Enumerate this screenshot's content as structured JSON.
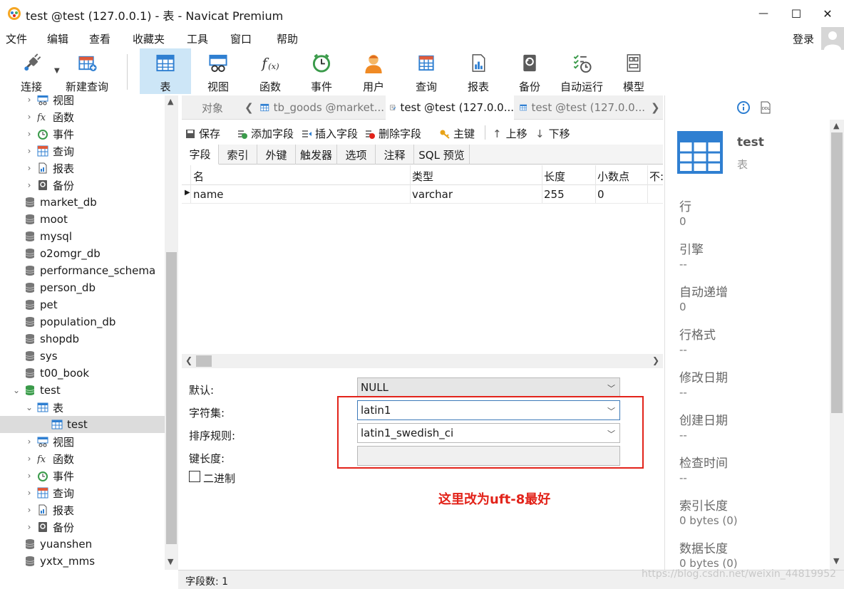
{
  "window": {
    "title": "test @test (127.0.0.1) - 表 - Navicat Premium",
    "minimize": "—",
    "maximize": "☐",
    "close": "✕"
  },
  "menu": [
    "文件",
    "编辑",
    "查看",
    "收藏夹",
    "工具",
    "窗口",
    "帮助"
  ],
  "login_label": "登录",
  "toolbar": [
    {
      "label": "连接",
      "icon": "plug-icon"
    },
    {
      "label": "新建查询",
      "icon": "new-query-icon"
    },
    {
      "label": "表",
      "icon": "table-icon"
    },
    {
      "label": "视图",
      "icon": "view-icon"
    },
    {
      "label": "函数",
      "icon": "function-icon"
    },
    {
      "label": "事件",
      "icon": "clock-icon"
    },
    {
      "label": "用户",
      "icon": "user-icon"
    },
    {
      "label": "查询",
      "icon": "query-icon"
    },
    {
      "label": "报表",
      "icon": "report-icon"
    },
    {
      "label": "备份",
      "icon": "backup-icon"
    },
    {
      "label": "自动运行",
      "icon": "schedule-icon"
    },
    {
      "label": "模型",
      "icon": "model-icon"
    }
  ],
  "tree": [
    {
      "label": "视图",
      "type": "view"
    },
    {
      "label": "函数",
      "type": "function"
    },
    {
      "label": "事件",
      "type": "event"
    },
    {
      "label": "查询",
      "type": "query"
    },
    {
      "label": "报表",
      "type": "report"
    },
    {
      "label": "备份",
      "type": "backup"
    },
    {
      "label": "market_db",
      "type": "db"
    },
    {
      "label": "moot",
      "type": "db"
    },
    {
      "label": "mysql",
      "type": "db"
    },
    {
      "label": "o2omgr_db",
      "type": "db"
    },
    {
      "label": "performance_schema",
      "type": "db"
    },
    {
      "label": "person_db",
      "type": "db"
    },
    {
      "label": "pet",
      "type": "db"
    },
    {
      "label": "population_db",
      "type": "db"
    },
    {
      "label": "shopdb",
      "type": "db"
    },
    {
      "label": "sys",
      "type": "db"
    },
    {
      "label": "t00_book",
      "type": "db"
    },
    {
      "label": "test",
      "type": "db-open"
    },
    {
      "label": "表",
      "type": "tables"
    },
    {
      "label": "test",
      "type": "table"
    },
    {
      "label": "视图",
      "type": "view"
    },
    {
      "label": "函数",
      "type": "function"
    },
    {
      "label": "事件",
      "type": "event"
    },
    {
      "label": "查询",
      "type": "query"
    },
    {
      "label": "报表",
      "type": "report"
    },
    {
      "label": "备份",
      "type": "backup"
    },
    {
      "label": "yuanshen",
      "type": "db"
    },
    {
      "label": "yxtx_mms",
      "type": "db"
    }
  ],
  "tabs": {
    "objects": "对象",
    "items": [
      "tb_goods @market...",
      "test @test (127.0.0...",
      "test @test (127.0.0..."
    ]
  },
  "editor_toolbar": [
    "保存",
    "添加字段",
    "插入字段",
    "删除字段",
    "主键",
    "上移",
    "下移"
  ],
  "subtabs": [
    "字段",
    "索引",
    "外键",
    "触发器",
    "选项",
    "注释",
    "SQL 预览"
  ],
  "grid": {
    "columns": [
      "名",
      "类型",
      "长度",
      "小数点",
      "不:"
    ],
    "rows": [
      {
        "name": "name",
        "type": "varchar",
        "length": "255",
        "decimals": "0"
      }
    ]
  },
  "form": {
    "default_label": "默认:",
    "default_value": "NULL",
    "charset_label": "字符集:",
    "charset_value": "latin1",
    "collation_label": "排序规则:",
    "collation_value": "latin1_swedish_ci",
    "keylen_label": "键长度:",
    "binary_label": "二进制"
  },
  "annotation": "这里改为uft-8最好",
  "status": "字段数: 1",
  "info": {
    "name": "test",
    "kind": "表",
    "props": [
      {
        "k": "行",
        "v": "0"
      },
      {
        "k": "引擎",
        "v": "--"
      },
      {
        "k": "自动递增",
        "v": "0"
      },
      {
        "k": "行格式",
        "v": "--"
      },
      {
        "k": "修改日期",
        "v": "--"
      },
      {
        "k": "创建日期",
        "v": "--"
      },
      {
        "k": "检查时间",
        "v": "--"
      },
      {
        "k": "索引长度",
        "v": "0 bytes (0)"
      },
      {
        "k": "数据长度",
        "v": "0 bytes (0)"
      }
    ]
  },
  "watermark": "https://blog.csdn.net/weixin_44819952",
  "colors": {
    "accent": "#2f7fd1",
    "annotation": "#e2231a",
    "selected_toolbar": "#cde6f7"
  }
}
